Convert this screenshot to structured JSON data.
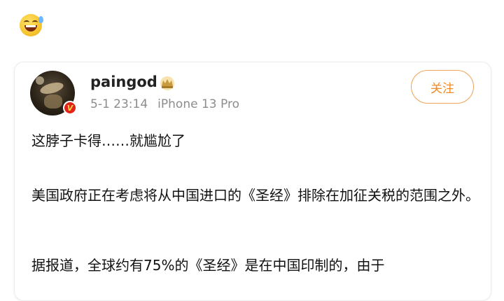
{
  "header": {
    "emoji_icon": "grinning-sweat-emoji-icon"
  },
  "post": {
    "username": "paingod",
    "verified_badge": "V",
    "timestamp": "5-1 23:14",
    "device": "iPhone 13 Pro",
    "follow_label": "关注",
    "paragraphs": [
      "这脖子卡得……就尴尬了",
      "美国政府正在考虑将从中国进口的《圣经》排除在加征关税的范围之外。",
      "据报道，全球约有75%的《圣经》是在中国印制的，由于"
    ]
  },
  "colors": {
    "accent": "#f08a24",
    "badge": "#e2231a",
    "meta": "#8c8c8c"
  }
}
